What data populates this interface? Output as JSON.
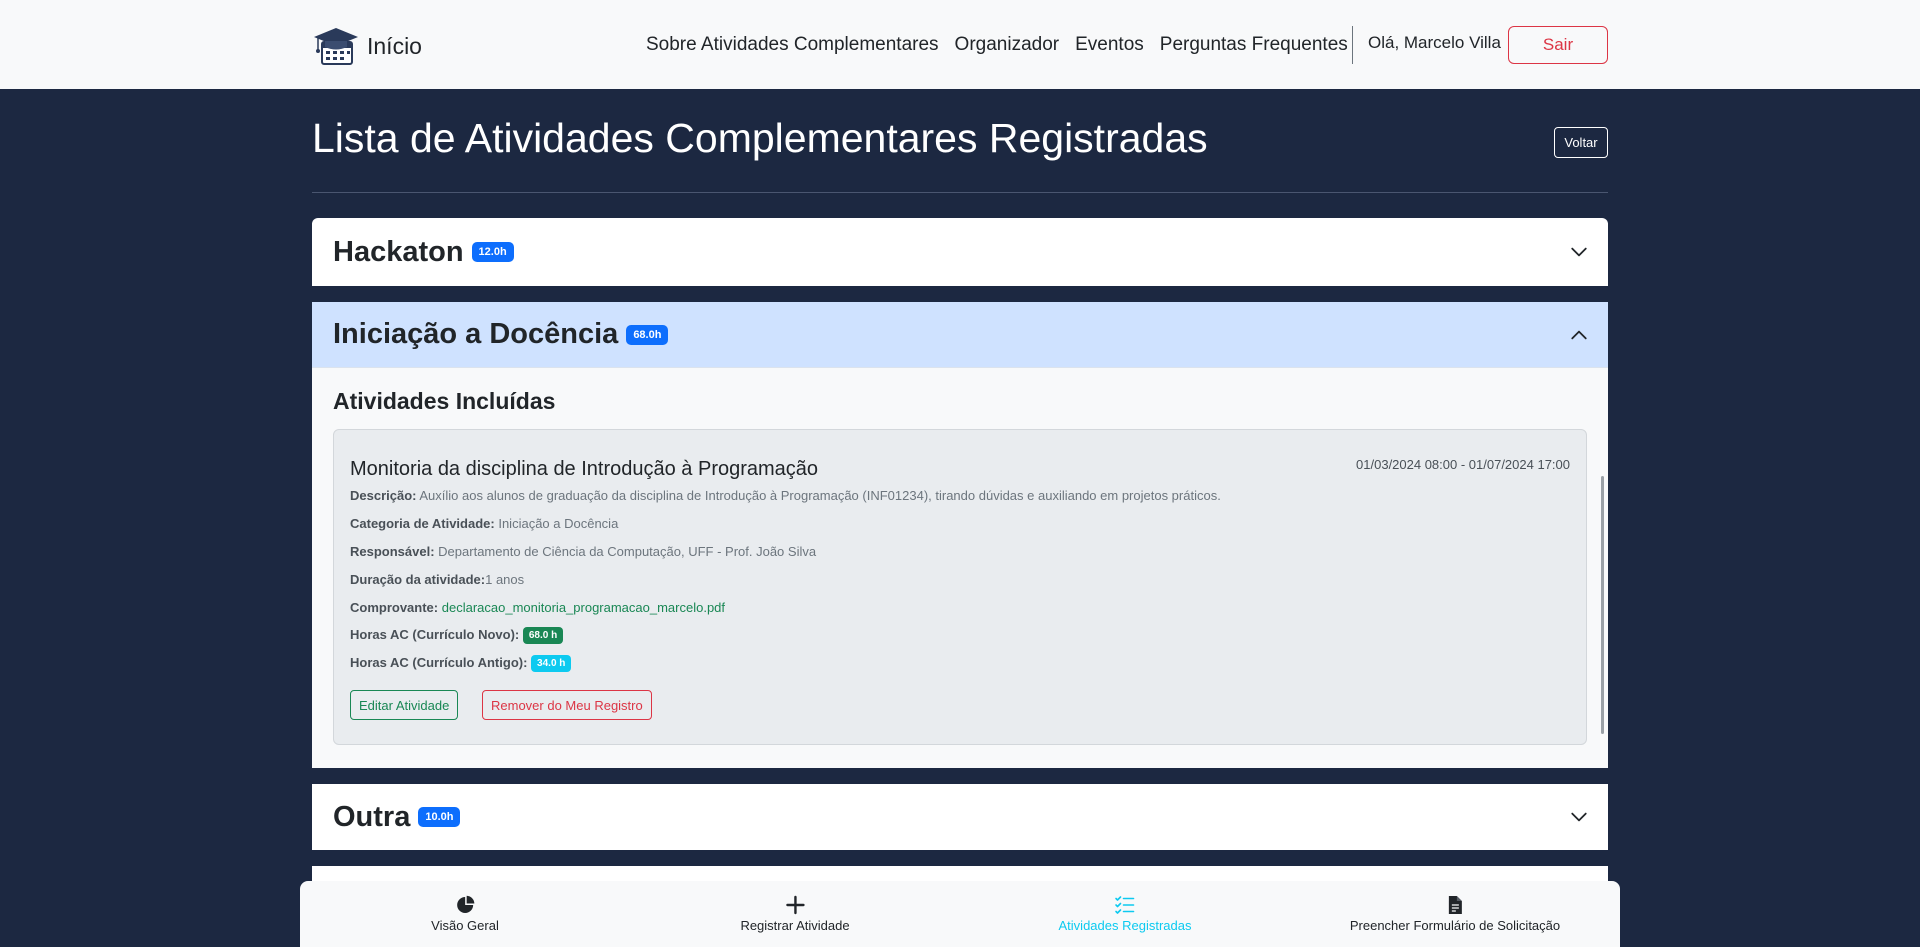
{
  "navbar": {
    "brand_label": "Início",
    "links": [
      "Sobre Atividades Complementares",
      "Organizador",
      "Eventos",
      "Perguntas Frequentes"
    ],
    "greeting": "Olá, Marcelo Villa",
    "logout_label": "Sair"
  },
  "page": {
    "title": "Lista de Atividades Complementares Registradas",
    "back_label": "Voltar"
  },
  "categories": [
    {
      "name": "Hackaton",
      "hours": "12.0h",
      "expanded": false
    },
    {
      "name": "Iniciação a Docência",
      "hours": "68.0h",
      "expanded": true
    },
    {
      "name": "Outra",
      "hours": "10.0h",
      "expanded": false
    }
  ],
  "expanded_section": {
    "heading": "Atividades Incluídas",
    "activity": {
      "title": "Monitoria da disciplina de Introdução à Programação",
      "date_range": "01/03/2024 08:00 - 01/07/2024 17:00",
      "description_label": "Descrição:",
      "description": "Auxílio aos alunos de graduação da disciplina de Introdução à Programação (INF01234), tirando dúvidas e auxiliando em projetos práticos.",
      "category_label": "Categoria de Atividade:",
      "category": "Iniciação a Docência",
      "responsible_label": "Responsável:",
      "responsible": "Departamento de Ciência da Computação, UFF - Prof. João Silva",
      "duration_label": "Duração da atividade:",
      "duration": "1 anos",
      "proof_label": "Comprovante:",
      "proof_file": "declaracao_monitoria_programacao_marcelo.pdf",
      "hours_new_label": "Horas AC (Currículo Novo):",
      "hours_new": "68.0 h",
      "hours_old_label": "Horas AC (Currículo Antigo):",
      "hours_old": "34.0 h",
      "edit_label": "Editar Atividade",
      "remove_label": "Remover do Meu Registro"
    }
  },
  "bottom_nav": {
    "items": [
      {
        "label": "Visão Geral",
        "icon": "pie-chart-icon",
        "active": false
      },
      {
        "label": "Registrar Atividade",
        "icon": "plus-icon",
        "active": false
      },
      {
        "label": "Atividades Registradas",
        "icon": "checklist-icon",
        "active": true
      },
      {
        "label": "Preencher Formulário de Solicitação",
        "icon": "document-icon",
        "active": false
      }
    ]
  },
  "colors": {
    "page_background": "#1c2841",
    "primary_badge": "#0d6efd",
    "active_nav": "#0dcaf0",
    "danger": "#dc3545",
    "success": "#198754",
    "expanded_header": "#cfe2ff"
  }
}
